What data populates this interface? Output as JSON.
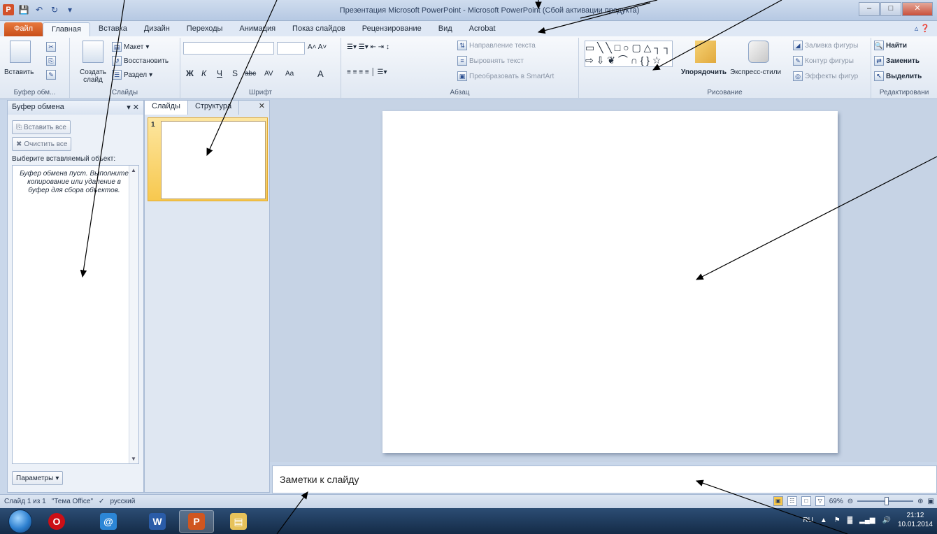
{
  "window": {
    "title": "Презентация Microsoft PowerPoint - Microsoft PowerPoint (Сбой активации продукта)",
    "app_icon": "P"
  },
  "tabs": [
    "Файл",
    "Главная",
    "Вставка",
    "Дизайн",
    "Переходы",
    "Анимация",
    "Показ слайдов",
    "Рецензирование",
    "Вид",
    "Acrobat"
  ],
  "ribbon": {
    "clipboard": {
      "paste": "Вставить",
      "label": "Буфер обм..."
    },
    "slides": {
      "new_slide": "Создать слайд",
      "layout": "Макет",
      "reset": "Восстановить",
      "section": "Раздел",
      "label": "Слайды"
    },
    "font": {
      "label": "Шрифт",
      "bold": "Ж",
      "italic": "К",
      "underline": "Ч",
      "shadow": "S",
      "strike": "abc",
      "spacing": "AV",
      "case": "Aa",
      "color": "A"
    },
    "paragraph": {
      "text_direction": "Направление текста",
      "align_text": "Выровнять текст",
      "smartart": "Преобразовать в SmartArt",
      "label": "Абзац"
    },
    "drawing": {
      "arrange": "Упорядочить",
      "quick_styles": "Экспресс-стили",
      "fill": "Заливка фигуры",
      "outline": "Контур фигуры",
      "effects": "Эффекты фигур",
      "label": "Рисование"
    },
    "editing": {
      "find": "Найти",
      "replace": "Заменить",
      "select": "Выделить",
      "label": "Редактировани"
    }
  },
  "clipboard_pane": {
    "title": "Буфер обмена",
    "paste_all": "Вставить все",
    "clear_all": "Очистить все",
    "choose_label": "Выберите вставляемый объект:",
    "empty_message": "Буфер обмена пуст. Выполните копирование или удаление в буфер для сбора объектов.",
    "options": "Параметры"
  },
  "slides_pane": {
    "tabs": [
      "Слайды",
      "Структура"
    ],
    "slide_number": "1"
  },
  "notes": {
    "placeholder": "Заметки к слайду"
  },
  "statusbar": {
    "slide_info": "Слайд 1 из 1",
    "theme": "\"Тема Office\"",
    "language": "русский",
    "zoom": "69%",
    "zoom_level": 0.69
  },
  "taskbar": {
    "lang": "RU",
    "time": "21:12",
    "date": "10.01.2014"
  },
  "colors": {
    "file_tab": "#d0561f",
    "accent": "#2a4d8f",
    "slide_thumb_highlight": "#f7c84e"
  }
}
